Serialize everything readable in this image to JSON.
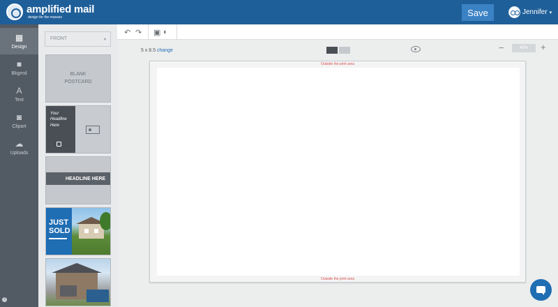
{
  "brand": {
    "name": "amplified mail",
    "tagline": "design for the masses",
    "color": "#1f5f99"
  },
  "header": {
    "save_label": "Save",
    "user_name": "Jennifer"
  },
  "nav": [
    {
      "label": "Design",
      "icon": "grid-icon",
      "active": true
    },
    {
      "label": "Bkgrnd",
      "icon": "background-icon"
    },
    {
      "label": "Text",
      "icon": "text-icon"
    },
    {
      "label": "Clipart",
      "icon": "camera-icon"
    },
    {
      "label": "Uploads",
      "icon": "cloud-upload-icon"
    }
  ],
  "panel": {
    "side_select": "FRONT",
    "templates": [
      {
        "label": "BLANK\nPOSTCARD"
      },
      {
        "label": "Your Headline Here"
      },
      {
        "label": "HEADLINE HERE"
      },
      {
        "label": "JUST SOLD"
      },
      {
        "label": ""
      }
    ]
  },
  "canvas": {
    "size_text": "5 x 8.5",
    "change_label": "change",
    "zoom_value": "40%",
    "outside_top": "Outside the print area",
    "outside_bottom": "Outside the print area"
  }
}
